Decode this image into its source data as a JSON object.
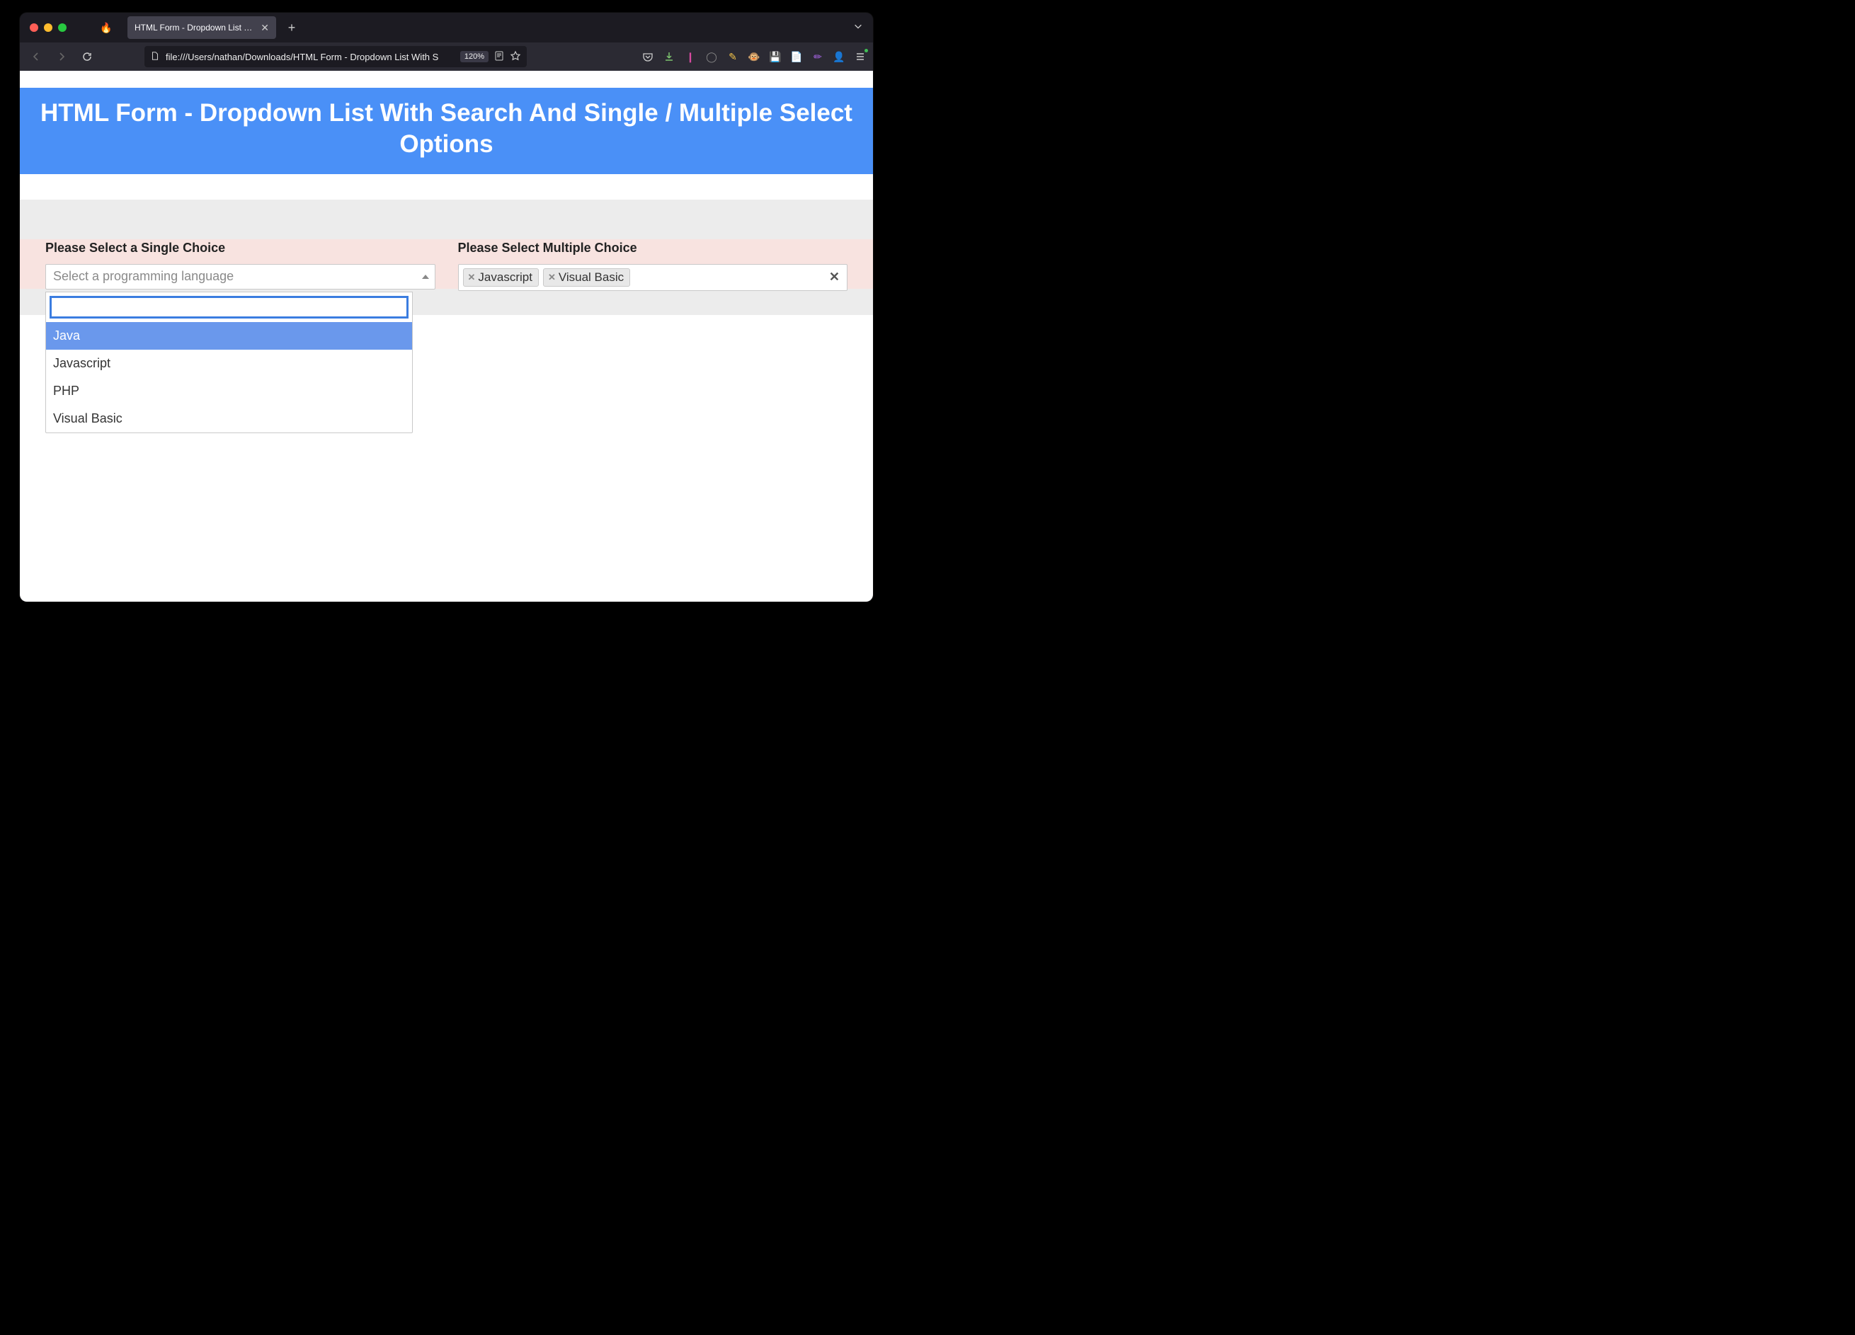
{
  "browser": {
    "tab_title": "HTML Form - Dropdown List With S",
    "url": "file:///Users/nathan/Downloads/HTML Form - Dropdown List With S",
    "zoom": "120%"
  },
  "page": {
    "banner_title": "HTML Form - Dropdown List With Search And Single / Multiple Select Options",
    "single": {
      "label": "Please Select a Single Choice",
      "placeholder": "Select a programming language",
      "search_value": "",
      "options": [
        "Java",
        "Javascript",
        "PHP",
        "Visual Basic"
      ],
      "highlighted_index": 0
    },
    "multiple": {
      "label": "Please Select Multiple Choice",
      "selected": [
        "Javascript",
        "Visual Basic"
      ]
    }
  }
}
